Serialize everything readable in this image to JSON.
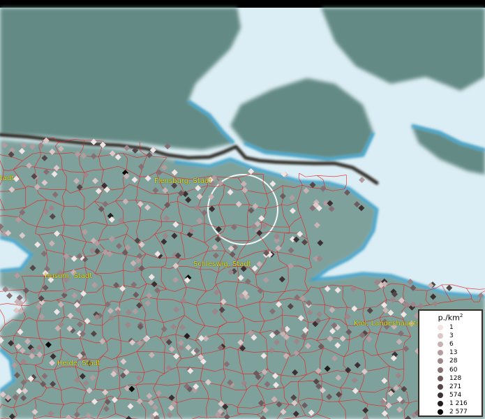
{
  "map": {
    "places": [
      {
        "name": "Flensburg, Stadt"
      },
      {
        "name": "Schleswig, Stadt"
      },
      {
        "name": "Husum, Stadt"
      },
      {
        "name": "Kiel, Landeshaupts"
      },
      {
        "name": "Heide, Stadt"
      },
      {
        "name": "tadt"
      }
    ]
  },
  "legend": {
    "title": "p./km",
    "title_sup": "2",
    "classes": [
      {
        "label": "1",
        "color": "#f0e4e4"
      },
      {
        "label": "3",
        "color": "#dcc8c8"
      },
      {
        "label": "6",
        "color": "#c8b2b4"
      },
      {
        "label": "13",
        "color": "#b29ca0"
      },
      {
        "label": "28",
        "color": "#9c8689"
      },
      {
        "label": "60",
        "color": "#857073"
      },
      {
        "label": "128",
        "color": "#6d5b5e"
      },
      {
        "label": "271",
        "color": "#554648"
      },
      {
        "label": "574",
        "color": "#3c3032"
      },
      {
        "label": "1 216",
        "color": "#241c1d"
      },
      {
        "label": "2 577",
        "color": "#0a0707"
      }
    ]
  },
  "colors": {
    "land": "#7fa19c",
    "land_north": "#648a84",
    "water": "#dceef5",
    "coast": "#2f9fd0",
    "borders": "#e82020",
    "national_border": "#1a1210",
    "labels": "#e8e020"
  }
}
